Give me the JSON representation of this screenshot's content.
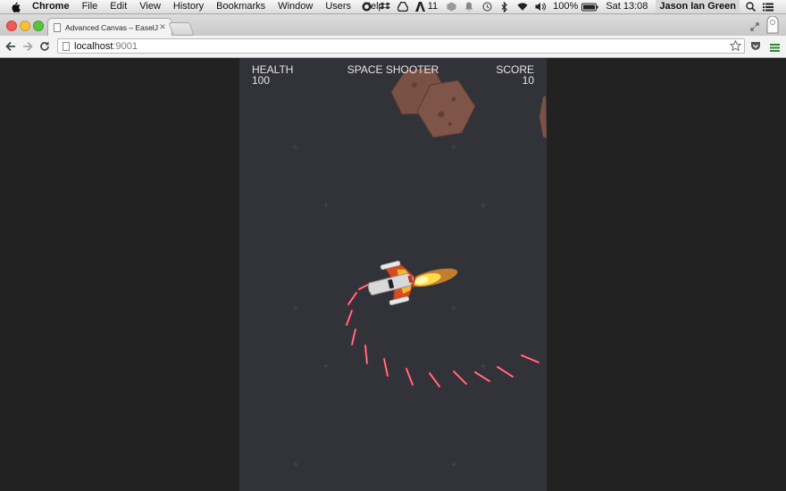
{
  "menubar": {
    "app": "Chrome",
    "items": [
      "File",
      "Edit",
      "View",
      "History",
      "Bookmarks",
      "Window",
      "Users",
      "Help"
    ],
    "status": {
      "notifications": "11",
      "battery": "100%",
      "clock": "Sat 13:08",
      "user": "Jason Ian Green"
    }
  },
  "browser": {
    "tab_title": "Advanced Canvas – EaselJS",
    "url_host": "localhost",
    "url_port": ":9001"
  },
  "game": {
    "title": "SPACE SHOOTER",
    "health_label": "HEALTH",
    "health_value": "100",
    "score_label": "SCORE",
    "score_value": "10",
    "colors": {
      "background": "#323239",
      "asteroid": "#7a5245",
      "ship_body": "#d9d9d9",
      "ship_wings": "#d64a24",
      "laser": "#e0304a"
    }
  }
}
